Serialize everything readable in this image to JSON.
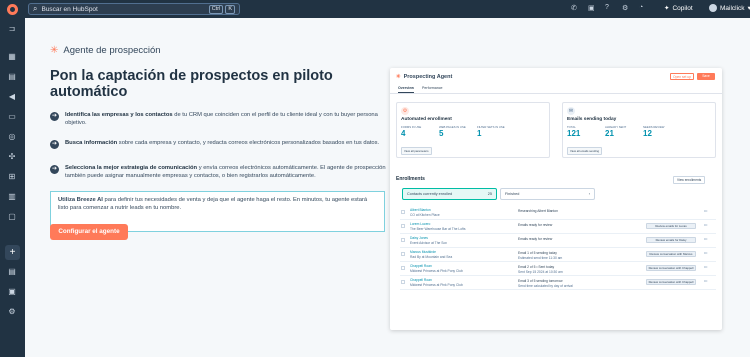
{
  "topbar": {
    "search_placeholder": "Buscar en HubSpot",
    "kbd_ctrl": "Ctrl",
    "kbd_k": "K",
    "copilot_label": "Copilot",
    "account_name": "Mailclick",
    "icons": [
      "phone-icon",
      "marketplace-icon",
      "help-icon",
      "settings-icon",
      "notifications-icon"
    ]
  },
  "page": {
    "title": "Agente de prospección",
    "headline": "Pon la captación de prospectos en piloto automático",
    "features": [
      {
        "bold": "Identifica las empresas y los contactos",
        "text": " de tu CRM que coinciden con el perfil de tu cliente ideal y con tu buyer persona objetivo."
      },
      {
        "bold": "Busca información",
        "text": " sobre cada empresa y contacto, y redacta correos electrónicos personalizados basados en tus datos."
      },
      {
        "bold": "Selecciona la mejor estrategia de comunicación",
        "text": " y envía correos electrónicos automáticamente. El agente de prospección también puede asignar manualmente empresas y contactos, o bien registrarlos automáticamente."
      }
    ],
    "note_bold": "Utiliza Breeze AI",
    "note_text": " para definir tus necesidades de venta y deja que el agente haga el resto. En minutos, tu agente estará listo para comenzar a nutrir leads en tu nombre.",
    "cta_label": "Configurar el agente"
  },
  "preview": {
    "title": "Prospecting Agent",
    "btn_secondary": "Open set up",
    "btn_primary": "Save",
    "tabs": [
      "Overview",
      "Performance"
    ],
    "auto": {
      "title": "Automated enrollment",
      "stats": [
        {
          "label": "FORMS IN USE",
          "value": "4"
        },
        {
          "label": "WEB PAGES IN USE",
          "value": "5"
        },
        {
          "label": "FILTER SETS IN USE",
          "value": "1"
        }
      ],
      "button": "View all parameters"
    },
    "emails": {
      "title": "Emails sending today",
      "stats": [
        {
          "label": "TOTAL",
          "value": "121"
        },
        {
          "label": "ALREADY SENT",
          "value": "21"
        },
        {
          "label": "NEEDS REVIEW",
          "value": "12"
        }
      ],
      "button": "View all emails sending"
    },
    "enrollments_title": "Enrollments",
    "view_enrollments": "View enrollments",
    "toggle_active": "Contacts currently enrolled",
    "toggle_active_count": "25",
    "toggle_inactive": "Finished",
    "rows": [
      {
        "name": "Albert Blanton",
        "company": "CO at Kitchen Place",
        "status": "Researching Albert Blanton",
        "status2": "",
        "action": ""
      },
      {
        "name": "Lorem Lucero",
        "company": "The Beer Warehouse Bar at The Lofts",
        "status": "Emails ready for review",
        "status2": "",
        "action": "Review emails for Lucas"
      },
      {
        "name": "Daisy Jones",
        "company": "Event Advisor at The Sox",
        "status": "Emails ready for review",
        "status2": "",
        "action": "Review emails for Daisy"
      },
      {
        "name": "Marcus Mustkirde",
        "company": "Rad By at Mountain and Sea",
        "status": "Email 1 of 5 sending today",
        "status2": "Estimated send time 11:30 am",
        "action": "Review conversation with Marcus"
      },
      {
        "name": "Chappell Roan",
        "company": "Midwest Princess at Pink Pony Club",
        "status": "Email 2 of 5 • Sent today",
        "status2": "Sent Sep 15 2024 at 10:30 am",
        "action": "Review conversation with Chappell"
      },
      {
        "name": "Chappell Roan",
        "company": "Midwest Princess at Pink Pony Club",
        "status": "Email 3 of 5 sending tomorrow",
        "status2": "Send time calculated by day of arrival",
        "action": "Review conversation with Chappell"
      }
    ]
  }
}
